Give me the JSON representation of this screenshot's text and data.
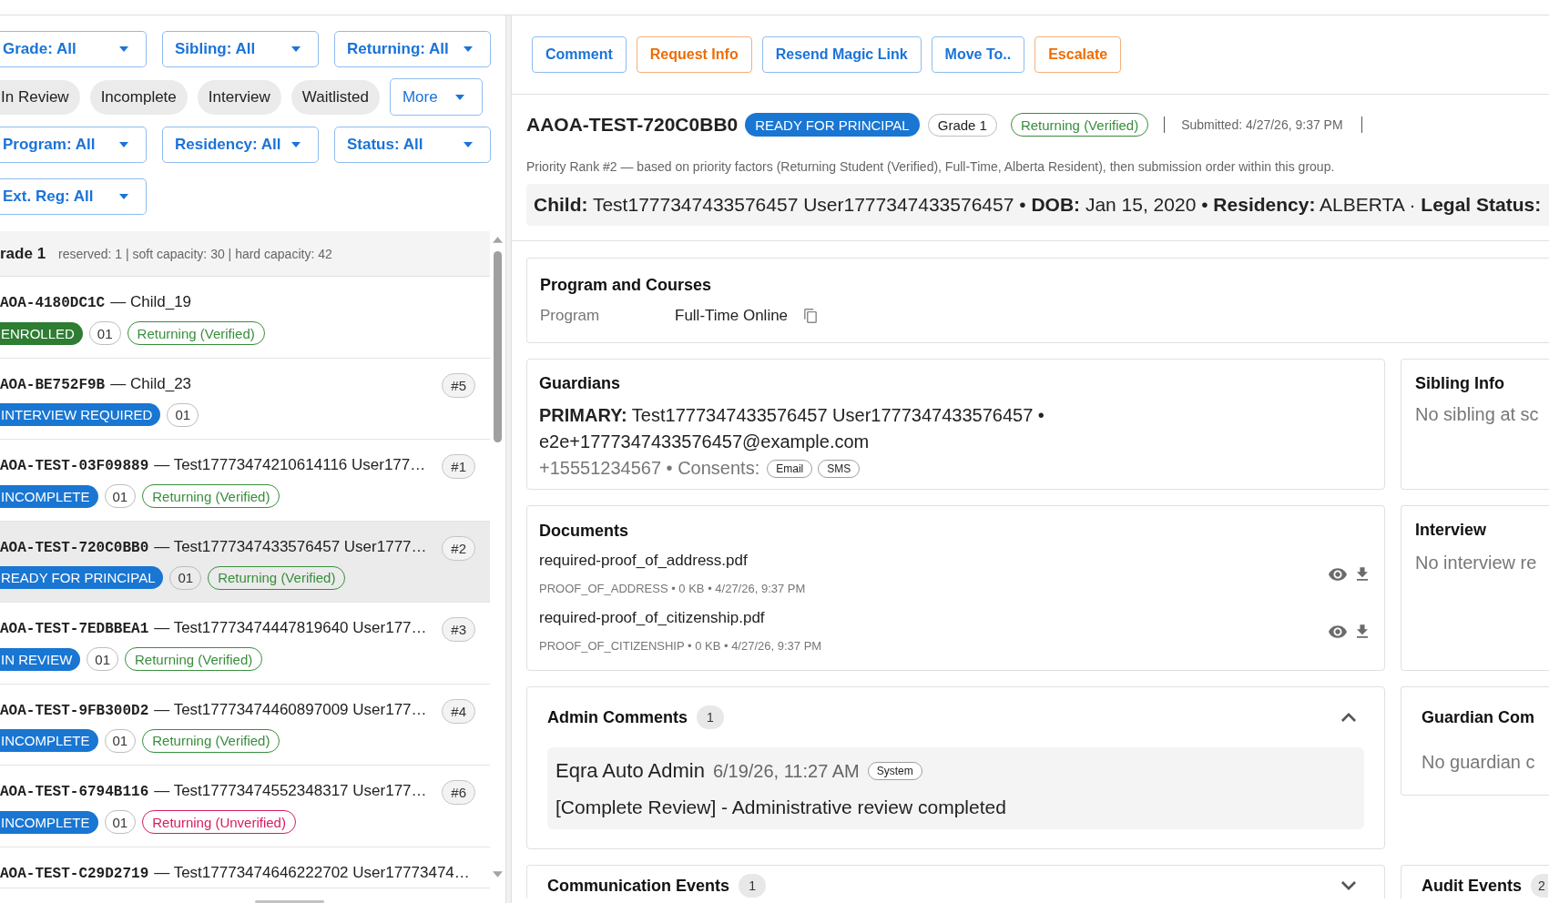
{
  "filters": {
    "selects_top": [
      {
        "label": "Grade: All"
      },
      {
        "label": "Sibling: All"
      },
      {
        "label": "Returning: All"
      }
    ],
    "status_chips": [
      {
        "label": "In Review",
        "selected": false
      },
      {
        "label": "Incomplete",
        "selected": false
      },
      {
        "label": "Interview",
        "selected": false
      },
      {
        "label": "Waitlisted",
        "selected": false
      }
    ],
    "more_menu": {
      "label": "More"
    },
    "selects_bottom": [
      {
        "label": "Program: All"
      },
      {
        "label": "Residency: All"
      },
      {
        "label": "Status: All"
      },
      {
        "label": "Ext. Reg: All"
      }
    ]
  },
  "queue": {
    "group": {
      "title": "rade 1",
      "meta": "reserved: 1 | soft capacity: 30 | hard capacity: 42"
    },
    "applications": [
      {
        "code": "AOA-4180DC1C",
        "name": "— Child_19",
        "status": {
          "label": "ENROLLED",
          "color": "#2e7d32"
        },
        "grade": "01",
        "returning": {
          "label": "Returning (Verified)",
          "color": "#388e3c"
        },
        "selected": false
      },
      {
        "code": "AOA-BE752F9B",
        "name": "— Child_23",
        "rank": "#5",
        "status": {
          "label": "INTERVIEW REQUIRED",
          "color": "#1976d2"
        },
        "grade": "01",
        "selected": false
      },
      {
        "code": "AOA-TEST-03F09889",
        "name": "— Test17773474210614116 User177…",
        "rank": "#1",
        "status": {
          "label": "INCOMPLETE",
          "color": "#1976d2"
        },
        "grade": "01",
        "returning": {
          "label": "Returning (Verified)",
          "color": "#388e3c"
        },
        "selected": false
      },
      {
        "code": "AOA-TEST-720C0BB0",
        "name": "— Test1777347433576457 User1777…",
        "rank": "#2",
        "status": {
          "label": "READY FOR PRINCIPAL",
          "color": "#1976d2"
        },
        "grade": "01",
        "returning": {
          "label": "Returning (Verified)",
          "color": "#388e3c"
        },
        "selected": true
      },
      {
        "code": "AOA-TEST-7EDBBEA1",
        "name": "— Test17773474447819640 User177…",
        "rank": "#3",
        "status": {
          "label": "IN REVIEW",
          "color": "#1976d2"
        },
        "grade": "01",
        "returning": {
          "label": "Returning (Verified)",
          "color": "#388e3c"
        },
        "selected": false
      },
      {
        "code": "AOA-TEST-9FB300D2",
        "name": "— Test17773474460897009 User177…",
        "rank": "#4",
        "status": {
          "label": "INCOMPLETE",
          "color": "#1976d2"
        },
        "grade": "01",
        "returning": {
          "label": "Returning (Verified)",
          "color": "#388e3c"
        },
        "selected": false
      },
      {
        "code": "AOA-TEST-6794B116",
        "name": "— Test17773474552348317 User177…",
        "rank": "#6",
        "status": {
          "label": "INCOMPLETE",
          "color": "#1976d2"
        },
        "grade": "01",
        "returning": {
          "label": "Returning (Unverified)",
          "color": "#d81b60"
        },
        "selected": false
      },
      {
        "code": "AOA-TEST-C29D2719",
        "name": "— Test17773474646222702 User17773474…",
        "selected": false
      }
    ]
  },
  "actions": [
    {
      "label": "Comment",
      "kind": "default"
    },
    {
      "label": "Request Info",
      "kind": "warning"
    },
    {
      "label": "Resend Magic Link",
      "kind": "default"
    },
    {
      "label": "Move To..",
      "kind": "default"
    },
    {
      "label": "Escalate",
      "kind": "warning"
    }
  ],
  "application": {
    "code": "AAOA-TEST-720C0BB0",
    "status": {
      "label": "READY FOR PRINCIPAL",
      "color": "#1976d2"
    },
    "grade": "Grade 1",
    "returning": {
      "label": "Returning (Verified)",
      "color": "#388e3c"
    },
    "submitted": "Submitted: 4/27/26, 9:37 PM",
    "priority_note": "Priority Rank #2 — based on priority factors (Returning Student (Verified), Full-Time, Alberta Resident), then submission order within this group.",
    "summary": "**Child:** Test1777347433576457 User1777347433576457 • **DOB:** Jan 15, 2020 • **Residency:** ALBERTA · **Legal Status:**"
  },
  "program_card": {
    "title": "Program and Courses",
    "fields": [
      {
        "label": "Program",
        "value": "Full-Time Online"
      }
    ]
  },
  "guardians": {
    "title": "Guardians",
    "primary": "**PRIMARY:** Test1777347433576457 User1777347433576457 • e2e+1777347433576457@example.com",
    "phone": "+15551234567 • Consents:",
    "consents": [
      "Email",
      "SMS"
    ]
  },
  "sibling_info": {
    "title": "Sibling Info",
    "text": "No sibling at sc"
  },
  "documents": {
    "title": "Documents",
    "files": [
      {
        "name": "required-proof_of_address.pdf",
        "meta": "PROOF_OF_ADDRESS • 0 KB • 4/27/26, 9:37 PM"
      },
      {
        "name": "required-proof_of_citizenship.pdf",
        "meta": "PROOF_OF_CITIZENSHIP • 0 KB • 4/27/26, 9:37 PM"
      }
    ]
  },
  "interview": {
    "title": "Interview",
    "text": "No interview re"
  },
  "admin_comments": {
    "title": "Admin Comments",
    "count": "1",
    "expanded": true,
    "comments": [
      {
        "author": "Eqra Auto Admin",
        "time": "6/19/26, 11:27 AM",
        "tag": "System",
        "text": "[Complete Review] - Administrative review completed"
      }
    ]
  },
  "guardian_comments": {
    "title": "Guardian Com",
    "text": "No guardian c"
  },
  "communication_events": {
    "title": "Communication Events",
    "count": "1",
    "expanded": false
  },
  "audit_events": {
    "title": "Audit Events",
    "count": "2"
  }
}
